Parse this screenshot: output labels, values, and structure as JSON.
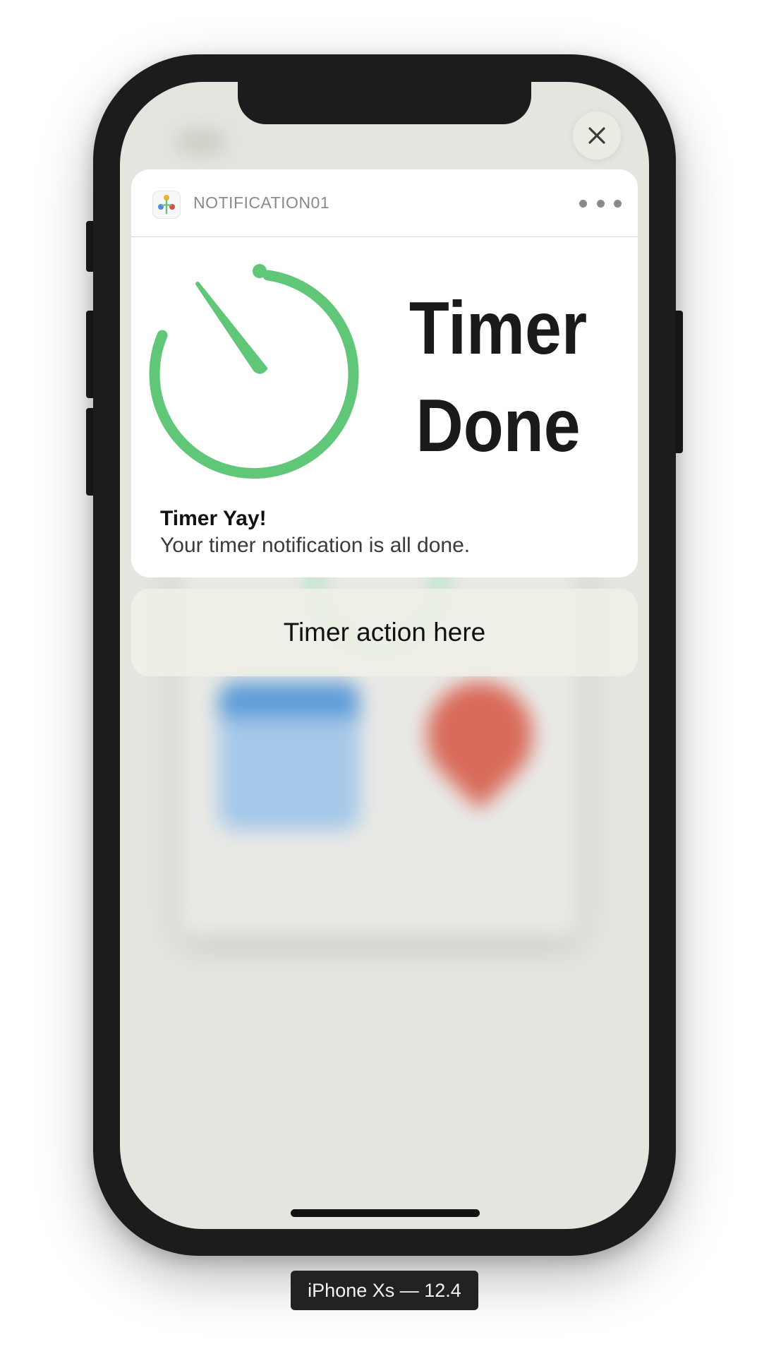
{
  "device": {
    "label": "iPhone Xs — 12.4"
  },
  "notification": {
    "app_name": "NOTIFICATION01",
    "image_text_line1": "Timer",
    "image_text_line2": "Done",
    "title": "Timer Yay!",
    "body": "Your timer notification is all done."
  },
  "action": {
    "label": "Timer action here"
  },
  "icons": {
    "close": "close-icon",
    "more": "more-icon",
    "app": "app-icon",
    "timer": "timer-icon"
  },
  "colors": {
    "timer_green": "#5fc777",
    "screen_bg": "#e5e5df",
    "frame": "#1c1c1c"
  }
}
